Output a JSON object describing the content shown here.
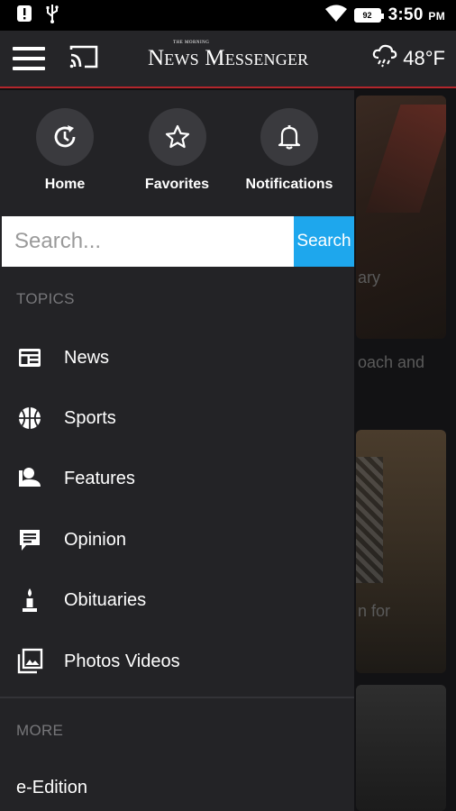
{
  "status_bar": {
    "battery": "92",
    "time": "3:50",
    "ampm": "PM"
  },
  "app_bar": {
    "logo_small": "THE MORNING",
    "logo": "News Messenger",
    "weather_temp": "48°F",
    "weather_icon": "cloud-rain-icon"
  },
  "quick_actions": [
    {
      "label": "Home",
      "icon": "home-refresh-icon"
    },
    {
      "label": "Favorites",
      "icon": "star-icon"
    },
    {
      "label": "Notifications",
      "icon": "bell-icon"
    }
  ],
  "search": {
    "placeholder": "Search...",
    "button_label": "Search"
  },
  "topics": {
    "header": "TOPICS",
    "items": [
      {
        "label": "News",
        "icon": "newspaper-icon"
      },
      {
        "label": "Sports",
        "icon": "basketball-icon"
      },
      {
        "label": "Features",
        "icon": "person-icon"
      },
      {
        "label": "Opinion",
        "icon": "comment-icon"
      },
      {
        "label": "Obituaries",
        "icon": "candle-icon"
      },
      {
        "label": "Photos Videos",
        "icon": "photo-library-icon"
      }
    ]
  },
  "more": {
    "header": "MORE",
    "items": [
      {
        "label": "e-Edition"
      }
    ]
  },
  "background_text": {
    "line1": "ary",
    "line2": "oach and",
    "line3": "n for"
  },
  "colors": {
    "accent_blue": "#1ea7ed",
    "accent_red": "#b3262c",
    "drawer_bg": "#232326"
  }
}
